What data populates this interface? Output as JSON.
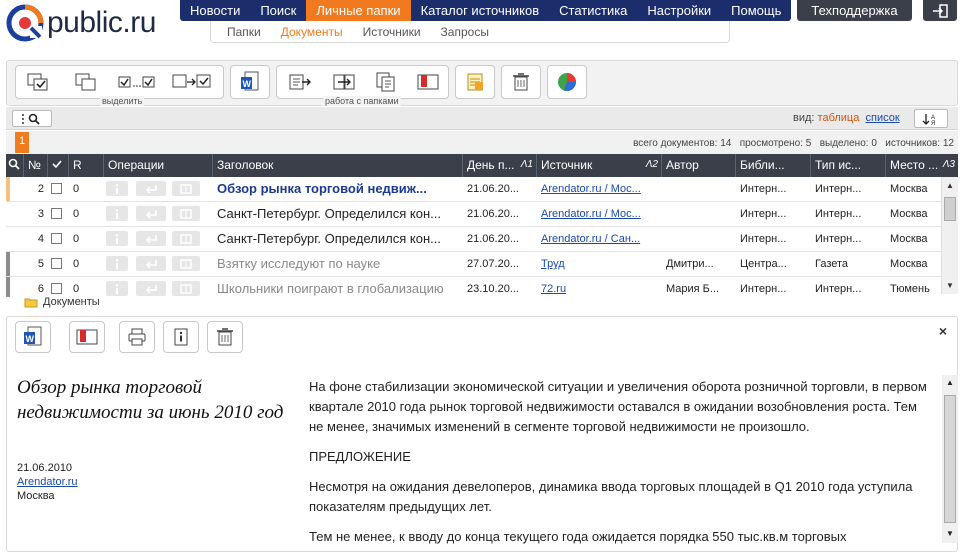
{
  "brand": {
    "name": "public.ru"
  },
  "topnav": {
    "items": [
      "Новости",
      "Поиск",
      "Личные папки",
      "Каталог источников",
      "Статистика",
      "Настройки",
      "Помощь"
    ],
    "support_label": "Техподдержка"
  },
  "subnav": {
    "items": [
      "Папки",
      "Документы",
      "Источники",
      "Запросы"
    ]
  },
  "toolbar": {
    "select_label": "выделить",
    "folders_label": "работа с папками"
  },
  "view": {
    "label": "вид:",
    "current": "таблица",
    "alt": "список"
  },
  "pagination": {
    "current_page": "1"
  },
  "stats": {
    "total": "всего документов: 14",
    "viewed": "просмотрено: 5",
    "selected": "выделено: 0",
    "sources": "источников: 12"
  },
  "table": {
    "columns": [
      "№",
      "R",
      "Операции",
      "Заголовок",
      "День п...",
      "Источник",
      "Автор",
      "Библи...",
      "Тип ис...",
      "Место ..."
    ],
    "sort_marks": [
      "Λ1",
      "Λ2",
      "Λ3"
    ],
    "rows": [
      {
        "n": "2",
        "r": "0",
        "title": "Обзор рынка торговой недвиж...",
        "date": "21.06.20...",
        "source": "Arendator.ru / Мос...",
        "author": "",
        "lib": "Интерн...",
        "type": "Интерн...",
        "place": "Москва"
      },
      {
        "n": "3",
        "r": "0",
        "title": "Санкт-Петербург. Определился кон...",
        "date": "21.06.20...",
        "source": "Arendator.ru / Мос...",
        "author": "",
        "lib": "Интерн...",
        "type": "Интерн...",
        "place": "Москва"
      },
      {
        "n": "4",
        "r": "0",
        "title": "Санкт-Петербург. Определился кон...",
        "date": "21.06.20...",
        "source": "Arendator.ru / Сан...",
        "author": "",
        "lib": "Интерн...",
        "type": "Интерн...",
        "place": "Москва"
      },
      {
        "n": "5",
        "r": "0",
        "title": "Взятку исследуют по науке",
        "date": "27.07.20...",
        "source": "Труд",
        "author": "Дмитри...",
        "lib": "Центра...",
        "type": "Газета",
        "place": "Москва"
      },
      {
        "n": "6",
        "r": "0",
        "title": "Школьники поиграют в глобализацию",
        "date": "23.10.20...",
        "source": "72.ru",
        "author": "Мария Б...",
        "lib": "Интерн...",
        "type": "Интерн...",
        "place": "Тюмень"
      }
    ]
  },
  "folder": {
    "label": "Документы"
  },
  "document": {
    "title": "Обзор рынка торговой недвижимости за июнь 2010 год",
    "date": "21.06.2010",
    "source": "Arendator.ru",
    "place": "Москва",
    "paragraphs": [
      "На фоне стабилизации экономической ситуации и увеличения оборота розничной торговли, в первом квартале 2010 года рынок торговой недвижимости оставался в ожидании возобновления роста. Тем не менее, значимых изменений в сегменте торговой недвижимости не произошло.",
      "ПРЕДЛОЖЕНИЕ",
      "Несмотря на ожидания девелоперов, динамика ввода торговых площадей в Q1 2010 года уступила показателям предыдущих лет.",
      "Тем не менее, к вводу до конца текущего года ожидается порядка 550 тыс.кв.м торговых"
    ]
  },
  "colors": {
    "nav": "#1b2d6b",
    "accent": "#f07a1d",
    "header_dark": "#3b3f4a",
    "link": "#1a4aa8"
  }
}
